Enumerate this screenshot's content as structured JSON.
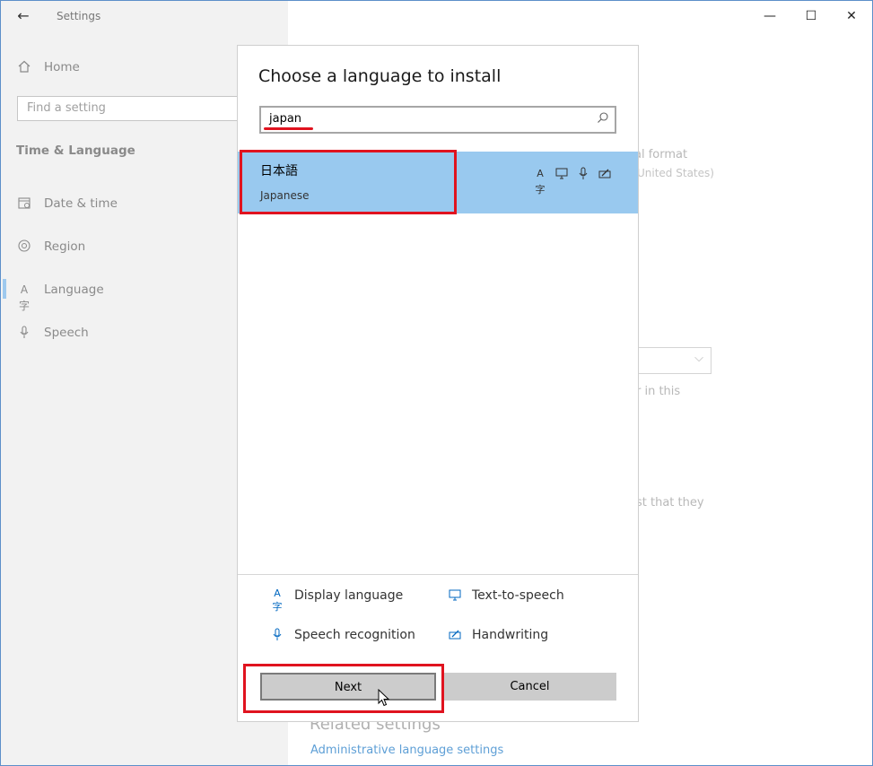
{
  "window": {
    "app_title": "Settings",
    "back_icon": "←",
    "minimize_icon": "—",
    "maximize_icon": "☐",
    "close_icon": "✕"
  },
  "sidebar": {
    "home_label": "Home",
    "search_placeholder": "Find a setting",
    "section_title": "Time & Language",
    "items": [
      {
        "label": "Date & time",
        "icon": "calendar-icon"
      },
      {
        "label": "Region",
        "icon": "globe-icon"
      },
      {
        "label": "Language",
        "icon": "language-icon"
      },
      {
        "label": "Speech",
        "icon": "microphone-icon"
      }
    ]
  },
  "background": {
    "format_text": "al format",
    "format_sub": "United States)",
    "in_this": "r in this",
    "that_they": "st that they",
    "related_title": "Related settings",
    "admin_link": "Administrative language settings"
  },
  "dialog": {
    "title": "Choose a language to install",
    "search_value": "japan",
    "result": {
      "native_name": "日本語",
      "english_name": "Japanese"
    },
    "legend": {
      "display_language": "Display language",
      "text_to_speech": "Text-to-speech",
      "speech_recognition": "Speech recognition",
      "handwriting": "Handwriting"
    },
    "next_label": "Next",
    "cancel_label": "Cancel"
  },
  "colors": {
    "selection": "#99c9ef",
    "highlight_box": "#e0131f",
    "accent": "#0067c0"
  }
}
